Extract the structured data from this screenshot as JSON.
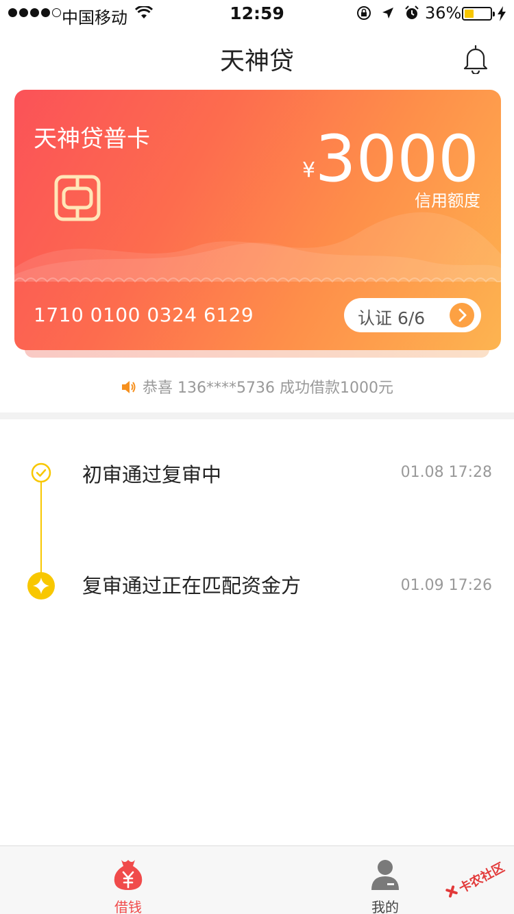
{
  "status_bar": {
    "carrier": "中国移动",
    "time": "12:59",
    "battery_percent": "36%",
    "battery_level": 0.36,
    "battery_color": "#f7c600"
  },
  "nav": {
    "title": "天神贷",
    "right_icon": "bell-icon"
  },
  "card": {
    "name": "天神贷普卡",
    "currency_symbol": "¥",
    "amount": "3000",
    "amount_label": "信用额度",
    "number": "1710 0100 0324 6129",
    "verify_label": "认证 6/6",
    "gradient_start": "#fb5258",
    "gradient_end": "#fdb450"
  },
  "notice": {
    "icon": "speaker-icon",
    "text": "恭喜 136****5736 成功借款1000元"
  },
  "timeline": [
    {
      "title": "初审通过复审中",
      "time": "01.08 17:28",
      "status": "done"
    },
    {
      "title": "复审通过正在匹配资金方",
      "time": "01.09 17:26",
      "status": "current"
    }
  ],
  "tabs": [
    {
      "label": "借钱",
      "icon": "money-bag-icon",
      "active": true
    },
    {
      "label": "我的",
      "icon": "user-icon",
      "active": false
    }
  ],
  "watermark": "卡农社区",
  "colors": {
    "accent": "#f04b4b",
    "timeline": "#f8c700",
    "muted_text": "#999999"
  }
}
